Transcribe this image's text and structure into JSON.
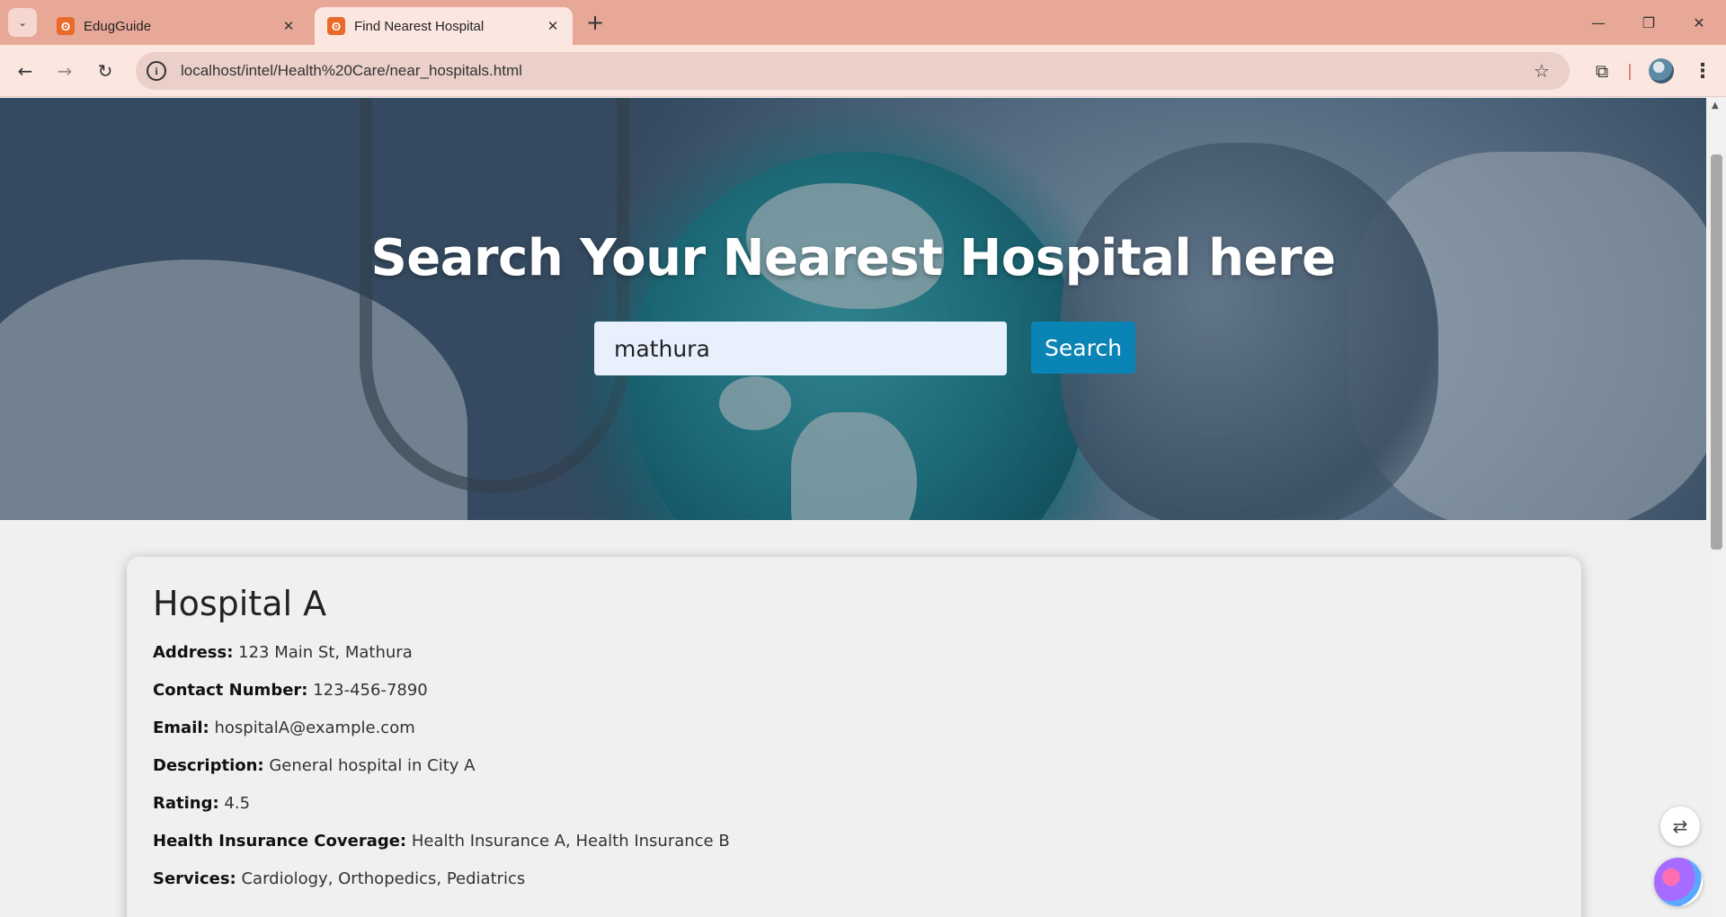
{
  "browser": {
    "tabs": [
      {
        "title": "EdugGuide",
        "active": false
      },
      {
        "title": "Find Nearest Hospital",
        "active": true
      }
    ],
    "url": "localhost/intel/Health%20Care/near_hospitals.html",
    "window_controls": {
      "minimize": "—",
      "restore": "❐",
      "close": "✕"
    }
  },
  "hero": {
    "heading": "Search Your Nearest Hospital here",
    "search": {
      "value": "mathura",
      "placeholder": ""
    },
    "search_button": "Search"
  },
  "hospital": {
    "name": "Hospital A",
    "fields": [
      {
        "label": "Address:",
        "value": "123 Main St, Mathura"
      },
      {
        "label": "Contact Number:",
        "value": "123-456-7890"
      },
      {
        "label": "Email:",
        "value": "hospitalA@example.com"
      },
      {
        "label": "Description:",
        "value": "General hospital in City A"
      },
      {
        "label": "Rating:",
        "value": "4.5"
      },
      {
        "label": "Health Insurance Coverage:",
        "value": "Health Insurance A, Health Insurance B"
      },
      {
        "label": "Services:",
        "value": "Cardiology, Orthopedics, Pediatrics"
      }
    ]
  },
  "colors": {
    "accent": "#0a84b4",
    "tabstrip": "#e8a898",
    "toolbar": "#fbe6e0"
  }
}
